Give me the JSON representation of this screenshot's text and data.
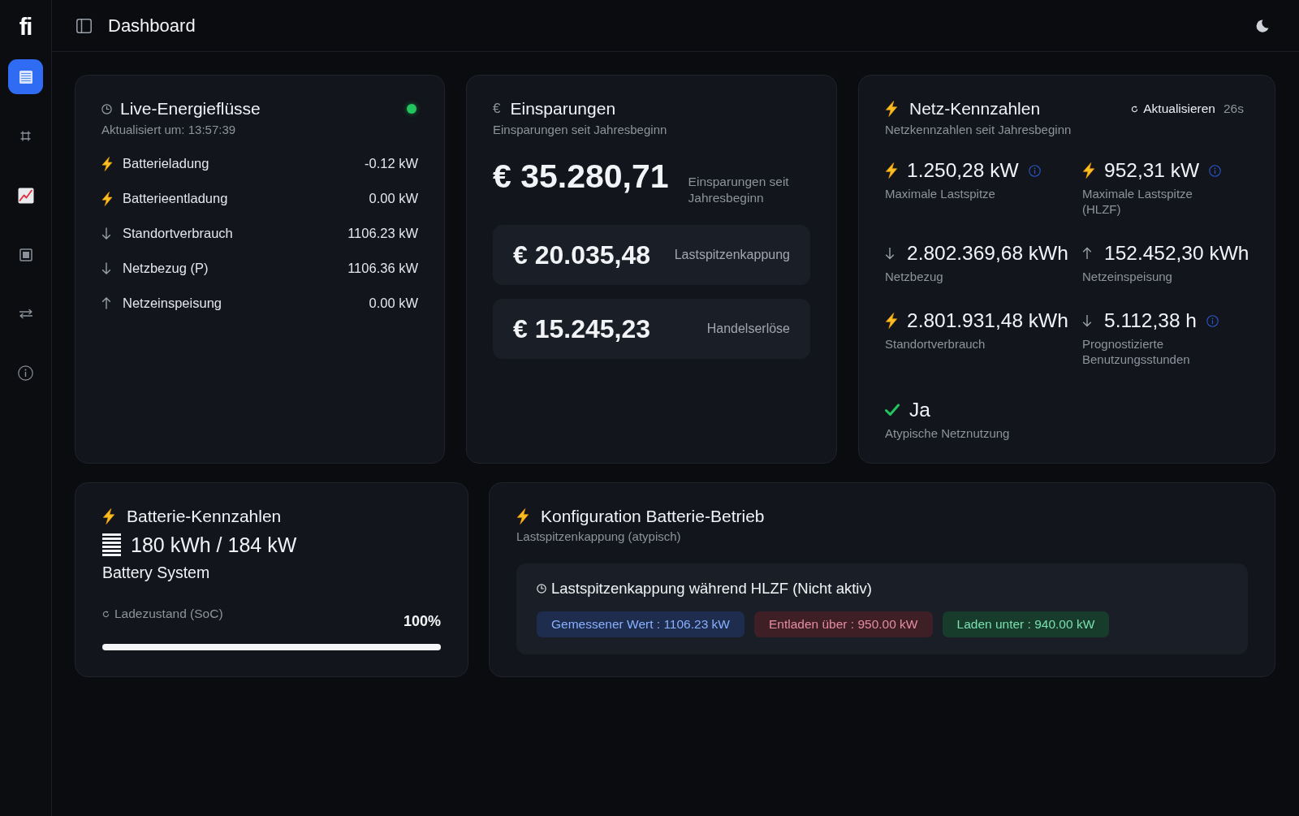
{
  "sidebar": {
    "logo": "fi",
    "items": [
      {
        "selected": true
      },
      {
        "selected": false
      },
      {
        "selected": false
      },
      {
        "selected": false
      },
      {
        "selected": false
      },
      {
        "selected": false
      }
    ]
  },
  "header": {
    "title": "Dashboard"
  },
  "live_flows": {
    "title": "Live-Energieflüsse",
    "live": true,
    "subtitle": "Aktualisiert um: 13:57:39",
    "rows": [
      {
        "kind": "power",
        "label": "Batterieladung",
        "value": "-0.12 kW"
      },
      {
        "kind": "power",
        "label": "Batterieentladung",
        "value": "0.00 kW"
      },
      {
        "kind": "in",
        "label": "Standortverbrauch",
        "value": "1106.23 kW"
      },
      {
        "kind": "in",
        "label": "Netzbezug (P)",
        "value": "1106.36 kW"
      },
      {
        "kind": "out",
        "label": "Netzeinspeisung",
        "value": "0.00 kW"
      }
    ]
  },
  "savings": {
    "symbol": "€",
    "title": "Einsparungen",
    "subtitle": "Einsparungen seit Jahresbeginn",
    "total": {
      "amount": "€ 35.280,71",
      "label": "Einsparungen seit Jahresbeginn"
    },
    "parts": [
      {
        "amount": "€ 20.035,48",
        "label": "Lastspitzenkappung"
      },
      {
        "amount": "€ 15.245,23",
        "label": "Handelserlöse"
      }
    ]
  },
  "grid_metrics": {
    "title": "Netz-Kennzahlen",
    "refresh": {
      "label": "Aktualisieren",
      "countdown": "26s"
    },
    "subtitle": "Netzkennzahlen seit Jahresbeginn",
    "metrics": [
      {
        "kind": "power",
        "value": "1.250,28 kW",
        "label": "Maximale Lastspitze",
        "info": true
      },
      {
        "kind": "power",
        "value": "952,31 kW",
        "label": "Maximale Lastspitze (HLZF)",
        "info": true
      },
      {
        "kind": "in",
        "value": "2.802.369,68 kWh",
        "label": "Netzbezug",
        "info": false
      },
      {
        "kind": "out",
        "value": "152.452,30 kWh",
        "label": "Netzeinspeisung",
        "info": false
      },
      {
        "kind": "power",
        "value": "2.801.931,48 kWh",
        "label": "Standortverbrauch",
        "info": false
      },
      {
        "kind": "in",
        "value": "5.112,38 h",
        "label": "Prognostizierte Benutzungsstunden",
        "info": true
      }
    ],
    "atypical_usage": {
      "checked": true,
      "value": "Ja",
      "label": "Atypische Netznutzung"
    }
  },
  "battery": {
    "title": "Batterie-Kennzahlen",
    "capacity": "180 kWh / 184 kW",
    "system": "Battery System",
    "soc": {
      "label": "Ladezustand (SoC)",
      "reading": "100%",
      "level": 1.0
    }
  },
  "battery_config": {
    "title": "Konfiguration Batterie-Betrieb",
    "subtitle": "Lastspitzenkappung (atypisch)",
    "rule": {
      "title": "Lastspitzenkappung während HLZF (Nicht aktiv)",
      "thresholds": [
        {
          "text": "Gemessener Wert : 1106.23 kW",
          "color": "#1e2c4e"
        },
        {
          "text": "Entladen über : 950.00 kW",
          "color": "#3e1f26"
        },
        {
          "text": "Laden unter : 940.00 kW",
          "color": "#183c2b"
        }
      ]
    }
  }
}
